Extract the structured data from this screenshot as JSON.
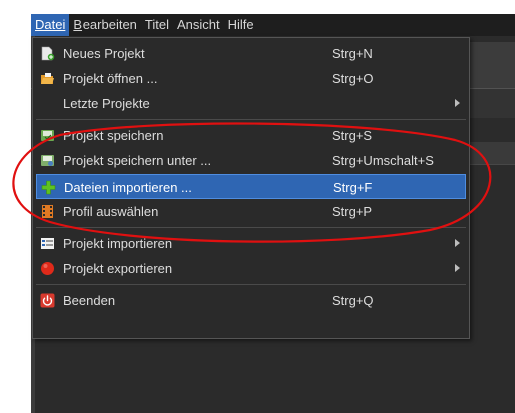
{
  "menubar": {
    "items": [
      {
        "label": "Datei",
        "active": true
      },
      {
        "label": "Bearbeiten",
        "active": false
      },
      {
        "label": "Titel",
        "active": false
      },
      {
        "label": "Ansicht",
        "active": false
      },
      {
        "label": "Hilfe",
        "active": false
      }
    ]
  },
  "file_menu": {
    "items": [
      {
        "icon": "new-project-icon",
        "label": "Neues Projekt",
        "shortcut": "Strg+N"
      },
      {
        "icon": "open-folder-icon",
        "label": "Projekt öffnen ...",
        "shortcut": "Strg+O"
      },
      {
        "icon": "",
        "label": "Letzte Projekte",
        "shortcut": "",
        "submenu": true
      },
      {
        "icon": "save-project-icon",
        "label": "Projekt speichern",
        "shortcut": "Strg+S"
      },
      {
        "icon": "save-as-icon",
        "label": "Projekt speichern unter ...",
        "shortcut": "Strg+Umschalt+S"
      },
      {
        "icon": "plus-icon",
        "label": "Dateien importieren ...",
        "shortcut": "Strg+F",
        "highlighted": true
      },
      {
        "icon": "film-profile-icon",
        "label": "Profil auswählen",
        "shortcut": "Strg+P"
      },
      {
        "icon": "import-project-icon",
        "label": "Projekt importieren",
        "shortcut": "",
        "submenu": true
      },
      {
        "icon": "red-circle-icon",
        "label": "Projekt exportieren",
        "shortcut": "",
        "submenu": true
      },
      {
        "icon": "power-icon",
        "label": "Beenden",
        "shortcut": "Strg+Q"
      }
    ]
  },
  "colors": {
    "highlight": "#2f66b3",
    "annotation": "#e01010",
    "plus_icon": "#5fc21f",
    "export_circle": "#e02a1a",
    "power_icon": "#d83a2e"
  }
}
